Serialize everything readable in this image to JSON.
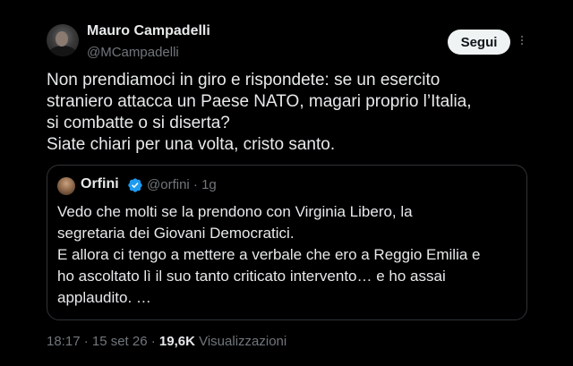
{
  "author": {
    "name": "Mauro Campadelli",
    "handle": "@MCampadelli"
  },
  "follow_label": "Segui",
  "tweet_text": "Non prendiamoci in giro e rispondete: se un esercito\nstraniero attacca un Paese NATO, magari proprio l’Italia,\nsi combatte o si diserta?\nSiate chiari per una volta, cristo santo.",
  "quote": {
    "name": "Orfini",
    "handle_time": "@orfini · 1g",
    "text": "Vedo che molti se la prendono con Virginia Libero, la\nsegretaria dei Giovani Democratici.\nE allora ci tengo a mettere a verbale che ero a Reggio Emilia e\nho ascoltato lì il suo tanto criticato intervento… e ho assai\napplaudito. …"
  },
  "meta": {
    "time_date": "18:17 · 15 set 26 · ",
    "views_count": "19,6K",
    "views_label": " Visualizzazioni"
  },
  "colors": {
    "background": "#000000",
    "text": "#e7e9ea",
    "muted": "#71767b",
    "verified": "#1d9bf0",
    "border": "#2f3336"
  }
}
